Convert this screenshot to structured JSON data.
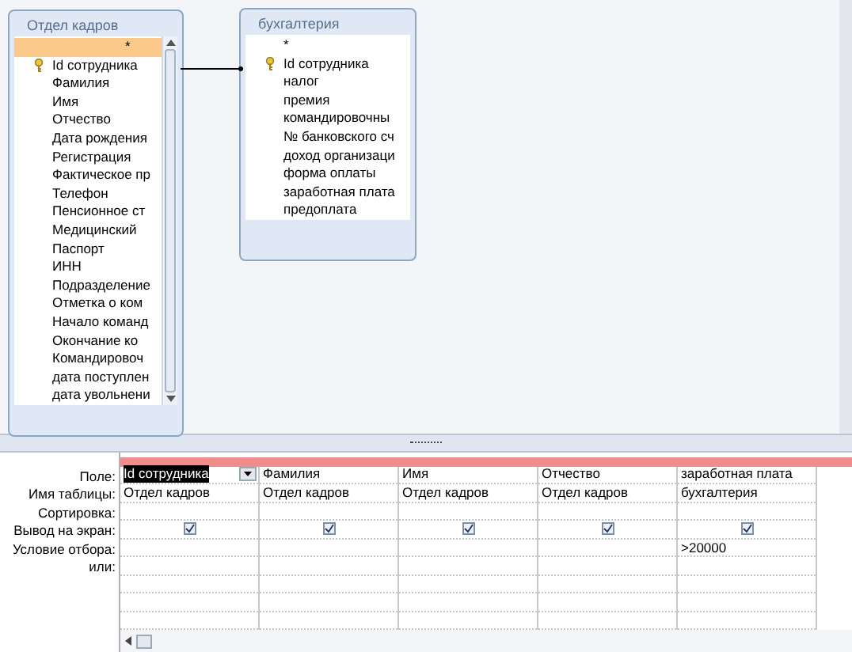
{
  "tables": [
    {
      "title": "Отдел кадров",
      "fields": [
        {
          "name": "*",
          "key": false,
          "selected": true
        },
        {
          "name": "Id  сотрудника",
          "key": true,
          "selected": false
        },
        {
          "name": "Фамилия",
          "key": false,
          "selected": false
        },
        {
          "name": "Имя",
          "key": false,
          "selected": false
        },
        {
          "name": "Отчество",
          "key": false,
          "selected": false
        },
        {
          "name": "Дата рождения",
          "key": false,
          "selected": false
        },
        {
          "name": "Регистрация",
          "key": false,
          "selected": false
        },
        {
          "name": "Фактическое пр",
          "key": false,
          "selected": false
        },
        {
          "name": "Телефон",
          "key": false,
          "selected": false
        },
        {
          "name": "Пенсионное ст",
          "key": false,
          "selected": false
        },
        {
          "name": "Медицинский",
          "key": false,
          "selected": false
        },
        {
          "name": "Паспорт",
          "key": false,
          "selected": false
        },
        {
          "name": "ИНН",
          "key": false,
          "selected": false
        },
        {
          "name": "Подразделение",
          "key": false,
          "selected": false
        },
        {
          "name": "Отметка о ком",
          "key": false,
          "selected": false
        },
        {
          "name": "Начало команд",
          "key": false,
          "selected": false
        },
        {
          "name": "Окончание ко",
          "key": false,
          "selected": false
        },
        {
          "name": "Командировоч",
          "key": false,
          "selected": false
        },
        {
          "name": "дата поступлен",
          "key": false,
          "selected": false
        },
        {
          "name": "дата увольнени",
          "key": false,
          "selected": false
        }
      ]
    },
    {
      "title": "бухгалтерия",
      "fields": [
        {
          "name": "*",
          "key": false,
          "selected": false
        },
        {
          "name": "Id  сотрудника",
          "key": true,
          "selected": false
        },
        {
          "name": "налог",
          "key": false,
          "selected": false
        },
        {
          "name": "премия",
          "key": false,
          "selected": false
        },
        {
          "name": "командировочны",
          "key": false,
          "selected": false
        },
        {
          "name": "№ банковского сч",
          "key": false,
          "selected": false
        },
        {
          "name": "доход организаци",
          "key": false,
          "selected": false
        },
        {
          "name": "форма оплаты",
          "key": false,
          "selected": false
        },
        {
          "name": "заработная плата",
          "key": false,
          "selected": false
        },
        {
          "name": "предоплата",
          "key": false,
          "selected": false
        }
      ]
    }
  ],
  "grid": {
    "row_labels": [
      "Поле:",
      "Имя таблицы:",
      "Сортировка:",
      "Вывод на экран:",
      "Условие отбора:",
      "или:"
    ],
    "columns": [
      {
        "field": "Id  сотрудника",
        "table": "Отдел кадров",
        "show": true,
        "selected": true
      },
      {
        "field": "Фамилия",
        "table": "Отдел кадров",
        "show": true,
        "selected": false
      },
      {
        "field": "Имя",
        "table": "Отдел кадров",
        "show": true,
        "selected": false
      },
      {
        "field": "Отчество",
        "table": "Отдел кадров",
        "show": true,
        "selected": false
      },
      {
        "field": "заработная плата",
        "table": "бухгалтерия",
        "show": true,
        "criteria": ">20000",
        "selected": false
      }
    ]
  }
}
